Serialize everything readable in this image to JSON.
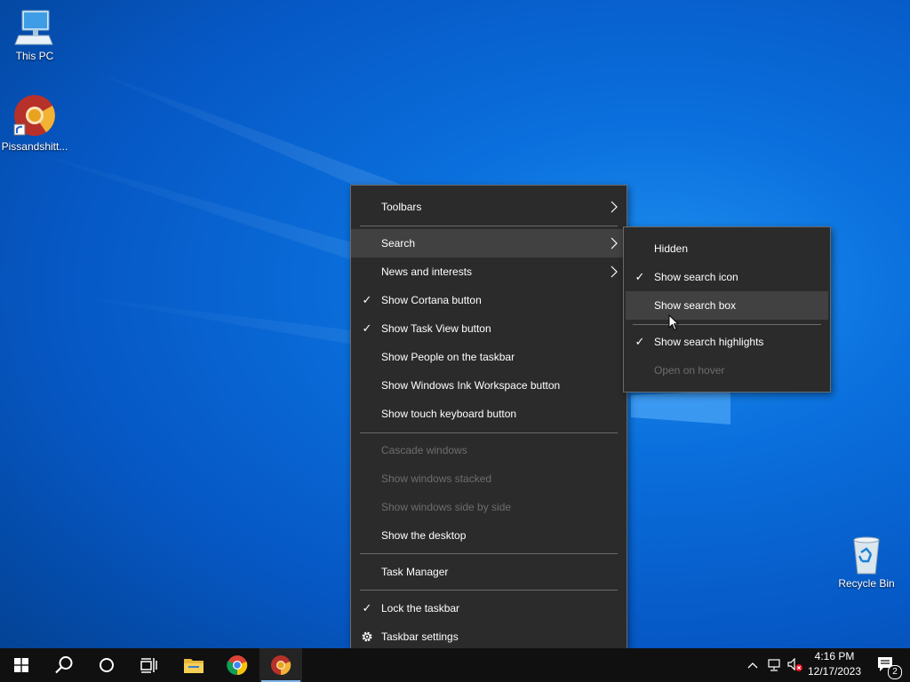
{
  "desktop": {
    "icons": [
      {
        "label": "This PC"
      },
      {
        "label": "Pissandshitt..."
      },
      {
        "label": "Recycle Bin"
      }
    ]
  },
  "context_menu": {
    "items": [
      {
        "label": "Toolbars",
        "checked": false,
        "submenu": true,
        "disabled": false
      },
      {
        "label": "Search",
        "checked": false,
        "submenu": true,
        "disabled": false,
        "highlighted": true
      },
      {
        "label": "News and interests",
        "checked": false,
        "submenu": true,
        "disabled": false
      },
      {
        "label": "Show Cortana button",
        "checked": true,
        "disabled": false
      },
      {
        "label": "Show Task View button",
        "checked": true,
        "disabled": false
      },
      {
        "label": "Show People on the taskbar",
        "checked": false,
        "disabled": false
      },
      {
        "label": "Show Windows Ink Workspace button",
        "checked": false,
        "disabled": false
      },
      {
        "label": "Show touch keyboard button",
        "checked": false,
        "disabled": false
      },
      {
        "label": "Cascade windows",
        "checked": false,
        "disabled": true
      },
      {
        "label": "Show windows stacked",
        "checked": false,
        "disabled": true
      },
      {
        "label": "Show windows side by side",
        "checked": false,
        "disabled": true
      },
      {
        "label": "Show the desktop",
        "checked": false,
        "disabled": false
      },
      {
        "label": "Task Manager",
        "checked": false,
        "disabled": false
      },
      {
        "label": "Lock the taskbar",
        "checked": true,
        "disabled": false
      },
      {
        "label": "Taskbar settings",
        "icon": "gear-icon",
        "disabled": false
      }
    ]
  },
  "search_submenu": {
    "items": [
      {
        "label": "Hidden",
        "checked": false,
        "disabled": false
      },
      {
        "label": "Show search icon",
        "checked": true,
        "disabled": false
      },
      {
        "label": "Show search box",
        "checked": false,
        "disabled": false,
        "highlighted": true
      },
      {
        "label": "Show search highlights",
        "checked": true,
        "disabled": false
      },
      {
        "label": "Open on hover",
        "checked": false,
        "disabled": true
      }
    ]
  },
  "taskbar": {
    "buttons": [
      "start-icon",
      "search-icon",
      "cortana-icon",
      "task-view-icon",
      "file-explorer-icon",
      "chrome-icon",
      "chrome-canary-icon"
    ],
    "tray_icons": [
      "chevron-up-icon",
      "network-icon",
      "volume-muted-icon"
    ],
    "clock": {
      "time": "4:16 PM",
      "date": "12/17/2023"
    },
    "notification_count": "2"
  },
  "colors": {
    "menu_bg": "#2b2b2b",
    "menu_highlight": "#414141",
    "disabled_text": "#6d6d6d",
    "taskbar_bg": "#101010",
    "desktop_blue": "#0a6fdc"
  }
}
